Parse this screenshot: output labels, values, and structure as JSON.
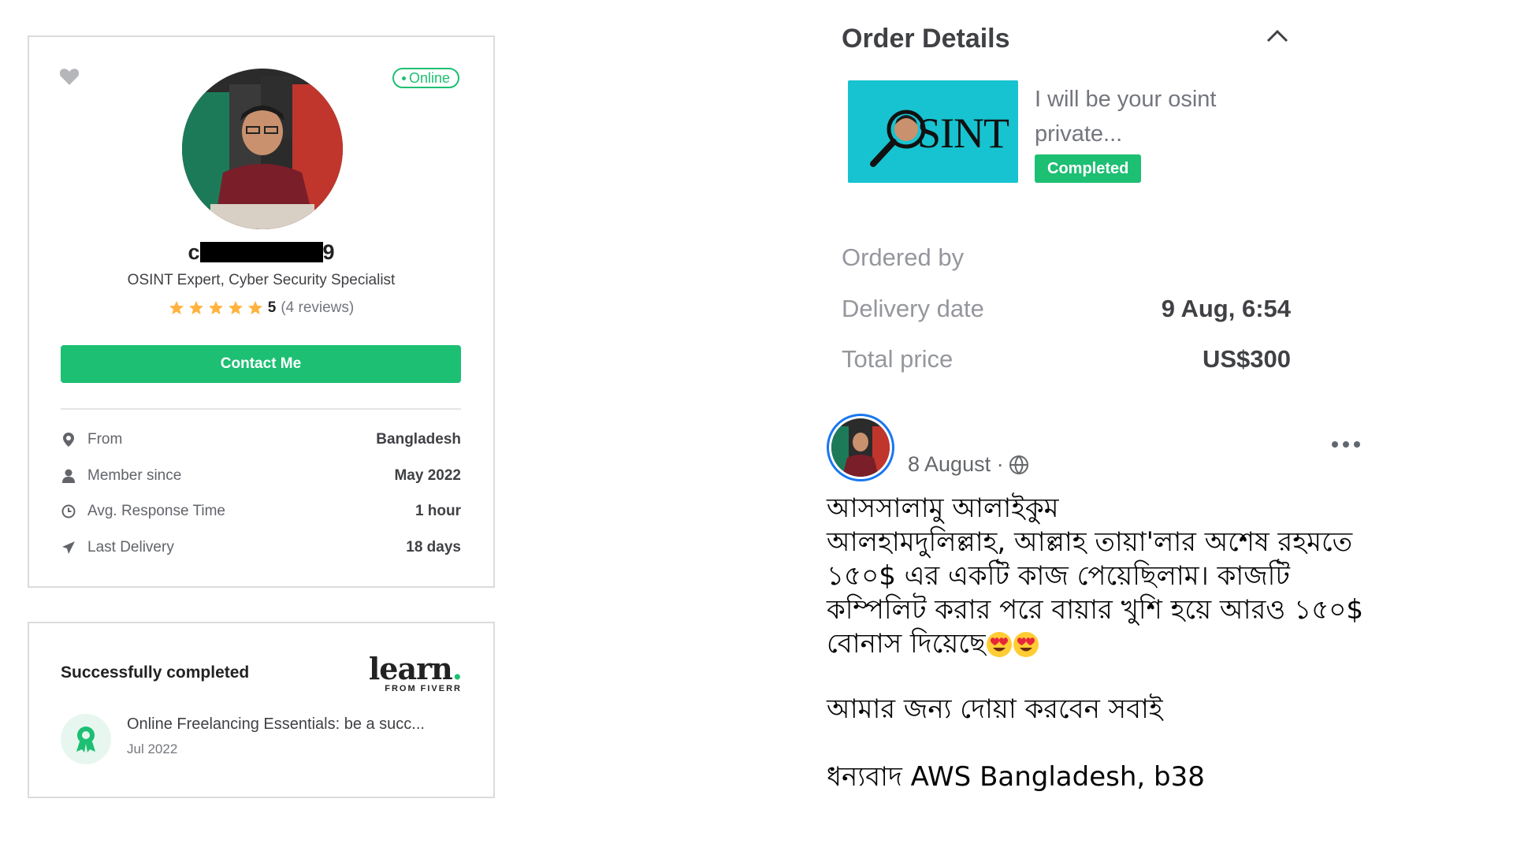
{
  "seller": {
    "status": "Online",
    "name_visible_start": "c",
    "name_visible_end": "9",
    "tagline": "OSINT Expert, Cyber Security Specialist",
    "rating": "5",
    "reviews": "(4 reviews)",
    "stars_filled": 5,
    "contact_label": "Contact Me",
    "info": [
      {
        "icon": "location-pin-icon",
        "label": "From",
        "value": "Bangladesh"
      },
      {
        "icon": "user-icon",
        "label": "Member since",
        "value": "May 2022"
      },
      {
        "icon": "clock-icon",
        "label": "Avg. Response Time",
        "value": "1 hour"
      },
      {
        "icon": "send-icon",
        "label": "Last Delivery",
        "value": "18 days"
      }
    ]
  },
  "learn": {
    "title": "Successfully completed",
    "logo_word": "learn",
    "logo_dot": ".",
    "logo_sub": "FROM FIVERR",
    "course": "Online Freelancing Essentials: be a succ...",
    "date": "Jul 2022"
  },
  "order": {
    "title": "Order Details",
    "gig_thumb_text": "SINT",
    "gig_title": "I will be your osint private...",
    "status": "Completed",
    "rows": [
      {
        "label": "Ordered by",
        "value": ""
      },
      {
        "label": "Delivery date",
        "value": "9 Aug, 6:54"
      },
      {
        "label": "Total price",
        "value": "US$300"
      }
    ]
  },
  "post": {
    "date": "8 August ·",
    "lines": [
      "আসসালামু আলাইকুম",
      "আলহামদুলিল্লাহ, আল্লাহ তায়া'লার অশেষ রহমতে",
      "১৫০$ এর একটি কাজ পেয়েছিলাম। কাজটি",
      "কম্পিলিট করার পরে বায়ার খুশি হয়ে আরও ১৫০$",
      "বোনাস দিয়েছে"
    ],
    "line_prayer": "আমার জন্য দোয়া করবেন সবাই",
    "line_thanks": "ধন্যবাদ AWS Bangladesh, b38"
  },
  "colors": {
    "brand_green": "#1dbf73",
    "thumb_cyan": "#17c3d0",
    "star_orange": "#ffb33e",
    "fb_blue": "#1877f2"
  }
}
